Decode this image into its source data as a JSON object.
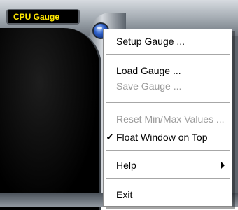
{
  "gauge": {
    "title": "CPU Gauge"
  },
  "menu": {
    "setup_gauge": "Setup Gauge ...",
    "load_gauge": "Load Gauge ...",
    "save_gauge": "Save Gauge ...",
    "reset_values": "Reset Min/Max Values ...",
    "float_on_top": "Float Window on Top",
    "float_on_top_checked": true,
    "checkmark": "✔",
    "help": "Help",
    "exit": "Exit"
  },
  "colors": {
    "title_text": "#ffe800",
    "disabled_text": "#9a9a9a",
    "menu_button": "#2d5ec7"
  },
  "icons": {
    "menu_button": "blue-orb-menu-icon",
    "submenu": "submenu-arrow-icon"
  }
}
